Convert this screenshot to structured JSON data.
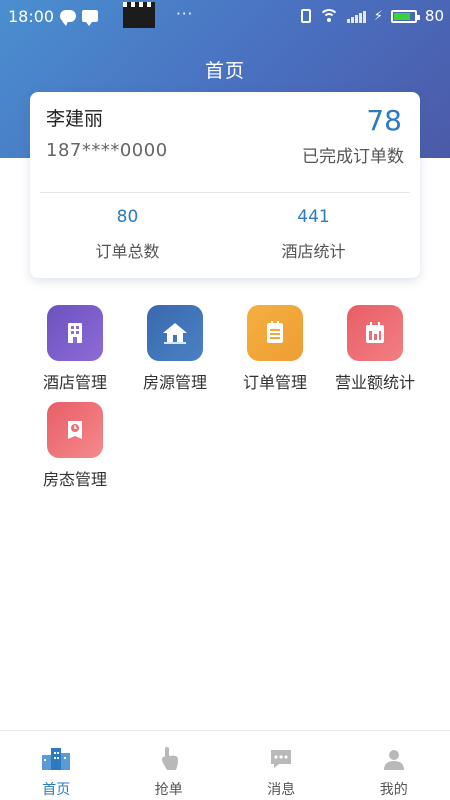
{
  "status_bar": {
    "time": "18:00",
    "battery_percent": "80",
    "battery_level": 0.8,
    "icons": [
      "chat-icon",
      "message-icon",
      "clapperboard-icon",
      "more-icon",
      "vibrate-icon",
      "wifi-icon",
      "signal-icon",
      "charging-icon",
      "battery-icon"
    ]
  },
  "header": {
    "title": "首页",
    "gradient_colors": [
      "#4a8fd0",
      "#4b5aa8"
    ]
  },
  "profile_card": {
    "name": "李建丽",
    "phone": "187****0000",
    "completed_orders_value": "78",
    "completed_orders_label": "已完成订单数",
    "stats": [
      {
        "value": "80",
        "label": "订单总数"
      },
      {
        "value": "441",
        "label": "酒店统计"
      }
    ],
    "accent_color": "#2d7ac0"
  },
  "menu": {
    "items": [
      {
        "label": "酒店管理",
        "icon": "hotel-building-icon",
        "color": "#7b5cc8"
      },
      {
        "label": "房源管理",
        "icon": "house-icon",
        "color": "#3f73b6"
      },
      {
        "label": "订单管理",
        "icon": "order-list-icon",
        "color": "#f2a93b"
      },
      {
        "label": "营业额统计",
        "icon": "calendar-chart-icon",
        "color": "#ee6d73"
      },
      {
        "label": "房态管理",
        "icon": "room-status-icon",
        "color": "#ee6d73"
      }
    ]
  },
  "tab_bar": {
    "tabs": [
      {
        "label": "首页",
        "icon": "home-buildings-icon",
        "active": true
      },
      {
        "label": "抢单",
        "icon": "grab-hand-icon",
        "active": false
      },
      {
        "label": "消息",
        "icon": "message-bubble-icon",
        "active": false
      },
      {
        "label": "我的",
        "icon": "profile-person-icon",
        "active": false
      }
    ],
    "active_color": "#2d7ac0",
    "inactive_icon_color": "#b9b9b9"
  }
}
